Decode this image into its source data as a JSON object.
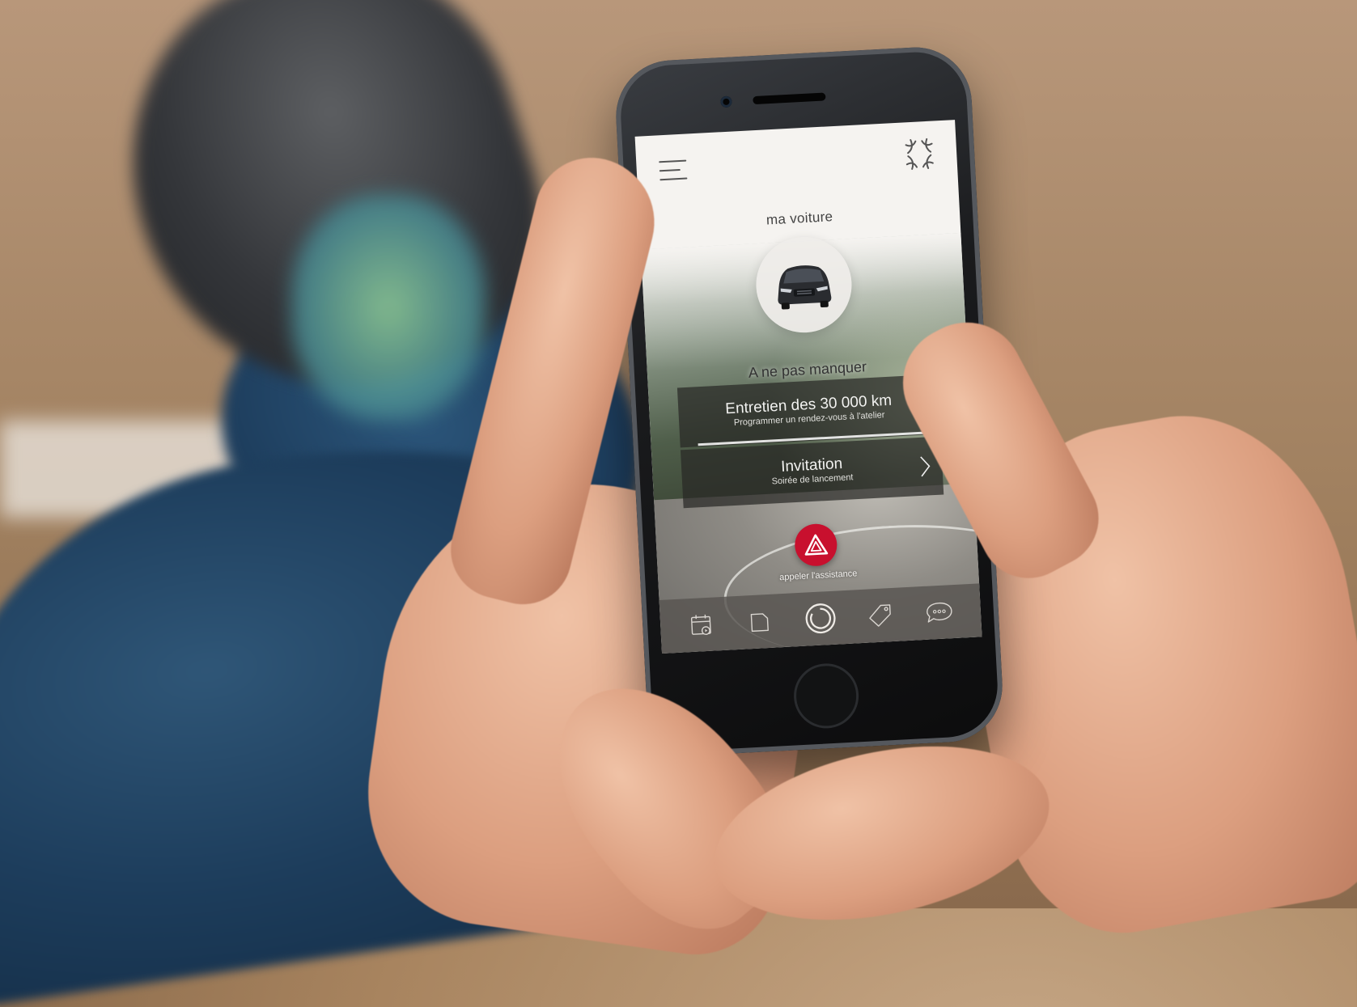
{
  "app": {
    "header": {
      "menu_icon": "hamburger-menu-icon",
      "logo_icon": "brand-logo-icon"
    },
    "vehicle": {
      "title": "ma voiture",
      "image_icon": "car-front-icon"
    },
    "highlights": {
      "title": "A ne pas manquer",
      "cards": [
        {
          "title": "Entretien des 30 000 km",
          "subtitle": "Programmer un rendez-vous à l'atelier",
          "icon": "chevron-right-icon"
        },
        {
          "title": "Invitation",
          "subtitle": "Soirée de lancement",
          "icon": "chevron-right-icon"
        }
      ]
    },
    "assistance": {
      "label": "appeler l'assistance",
      "icon": "hazard-warning-icon",
      "color": "#c8102e"
    },
    "tabbar": [
      {
        "icon": "calendar-icon"
      },
      {
        "icon": "folder-icon"
      },
      {
        "icon": "refresh-circle-icon"
      },
      {
        "icon": "tag-icon"
      },
      {
        "icon": "chat-bubble-icon"
      }
    ]
  }
}
